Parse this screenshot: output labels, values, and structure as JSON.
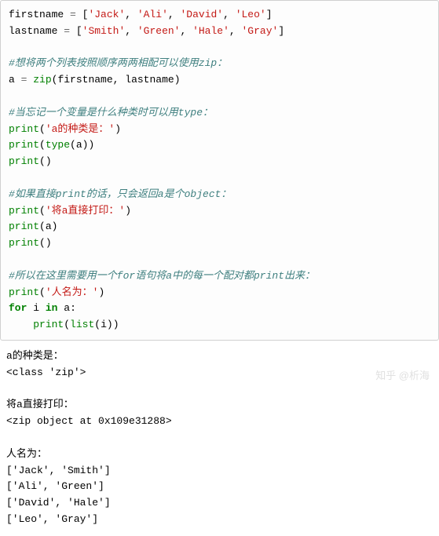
{
  "code": {
    "line1": {
      "var": "firstname",
      "eq": " = ",
      "lb": "[",
      "s1": "'Jack'",
      "c1": ", ",
      "s2": "'Ali'",
      "c2": ", ",
      "s3": "'David'",
      "c3": ", ",
      "s4": "'Leo'",
      "rb": "]"
    },
    "line2": {
      "var": "lastname",
      "eq": " = ",
      "lb": "[",
      "s1": "'Smith'",
      "c1": ", ",
      "s2": "'Green'",
      "c2": ", ",
      "s3": "'Hale'",
      "c3": ", ",
      "s4": "'Gray'",
      "rb": "]"
    },
    "comment1": "#想将两个列表按照顺序两两相配可以使用zip：",
    "line4": {
      "var": "a",
      "eq": " = ",
      "fn": "zip",
      "lp": "(",
      "arg1": "firstname",
      "comma": ", ",
      "arg2": "lastname",
      "rp": ")"
    },
    "comment2": "#当忘记一个变量是什么种类时可以用type：",
    "line6": {
      "fn": "print",
      "lp": "(",
      "arg": "'a的种类是：'",
      "rp": ")"
    },
    "line7": {
      "fn1": "print",
      "lp1": "(",
      "fn2": "type",
      "lp2": "(",
      "arg": "a",
      "rp2": ")",
      "rp1": ")"
    },
    "line8": {
      "fn": "print",
      "lp": "(",
      "rp": ")"
    },
    "comment3": "#如果直接print的话，只会返回a是个object：",
    "line10": {
      "fn": "print",
      "lp": "(",
      "arg": "'将a直接打印：'",
      "rp": ")"
    },
    "line11": {
      "fn": "print",
      "lp": "(",
      "arg": "a",
      "rp": ")"
    },
    "line12": {
      "fn": "print",
      "lp": "(",
      "rp": ")"
    },
    "comment4": "#所以在这里需要用一个for语句将a中的每一个配对都print出来：",
    "line14": {
      "fn": "print",
      "lp": "(",
      "arg": "'人名为：'",
      "rp": ")"
    },
    "line15": {
      "kw1": "for",
      "sp1": " ",
      "var": "i",
      "sp2": " ",
      "kw2": "in",
      "sp3": " ",
      "iter": "a",
      "colon": ":"
    },
    "line16": {
      "indent": "    ",
      "fn1": "print",
      "lp1": "(",
      "fn2": "list",
      "lp2": "(",
      "arg": "i",
      "rp2": ")",
      "rp1": ")"
    }
  },
  "output": {
    "h1": "a的种类是：",
    "o1": "<class 'zip'>",
    "blank1": "",
    "h2": "将a直接打印：",
    "o2": "<zip object at 0x109e31288>",
    "blank2": "",
    "h3": "人名为：",
    "r1": "['Jack', 'Smith']",
    "r2": "['Ali', 'Green']",
    "r3": "['David', 'Hale']",
    "r4": "['Leo', 'Gray']"
  },
  "watermark": "知乎 @析海"
}
